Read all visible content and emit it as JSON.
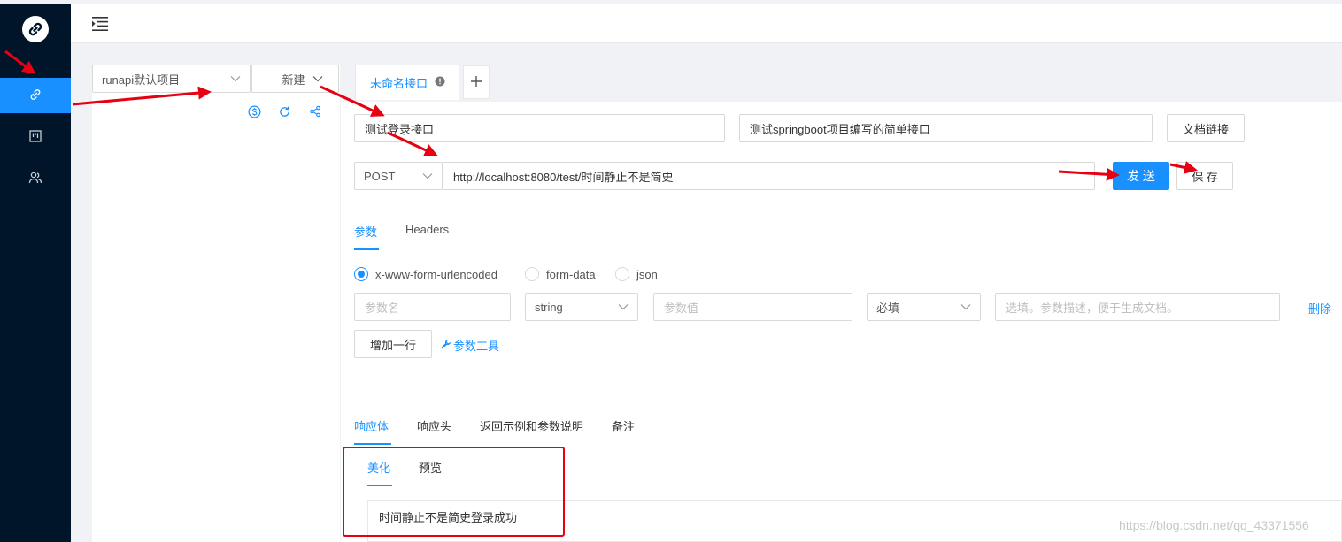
{
  "project": {
    "selected": "runapi默认项目",
    "new_label": "新建"
  },
  "tabs": [
    {
      "label": "未命名接口"
    }
  ],
  "api": {
    "name": "测试登录接口",
    "description": "测试springboot项目编写的简单接口",
    "doc_link_label": "文档链接",
    "method": "POST",
    "url": "http://localhost:8080/test/时间静止不是简史",
    "send_label": "发 送",
    "save_label": "保 存"
  },
  "request_tabs": [
    "参数",
    "Headers"
  ],
  "body_types": [
    "x-www-form-urlencoded",
    "form-data",
    "json"
  ],
  "param_row": {
    "name_placeholder": "参数名",
    "type": "string",
    "value_placeholder": "参数值",
    "required": "必填",
    "desc_placeholder": "选填。参数描述，便于生成文档。",
    "delete_label": "删除"
  },
  "add_row_label": "增加一行",
  "param_tool_label": "参数工具",
  "response_tabs": [
    "响应体",
    "响应头",
    "返回示例和参数说明",
    "备注"
  ],
  "response_view_tabs": [
    "美化",
    "预览"
  ],
  "response_body": "时间静止不是简史登录成功",
  "watermark": "https://blog.csdn.net/qq_43371556",
  "colors": {
    "nav_bg": "#001529",
    "primary": "#1890ff",
    "annotation_red": "#e60012"
  }
}
